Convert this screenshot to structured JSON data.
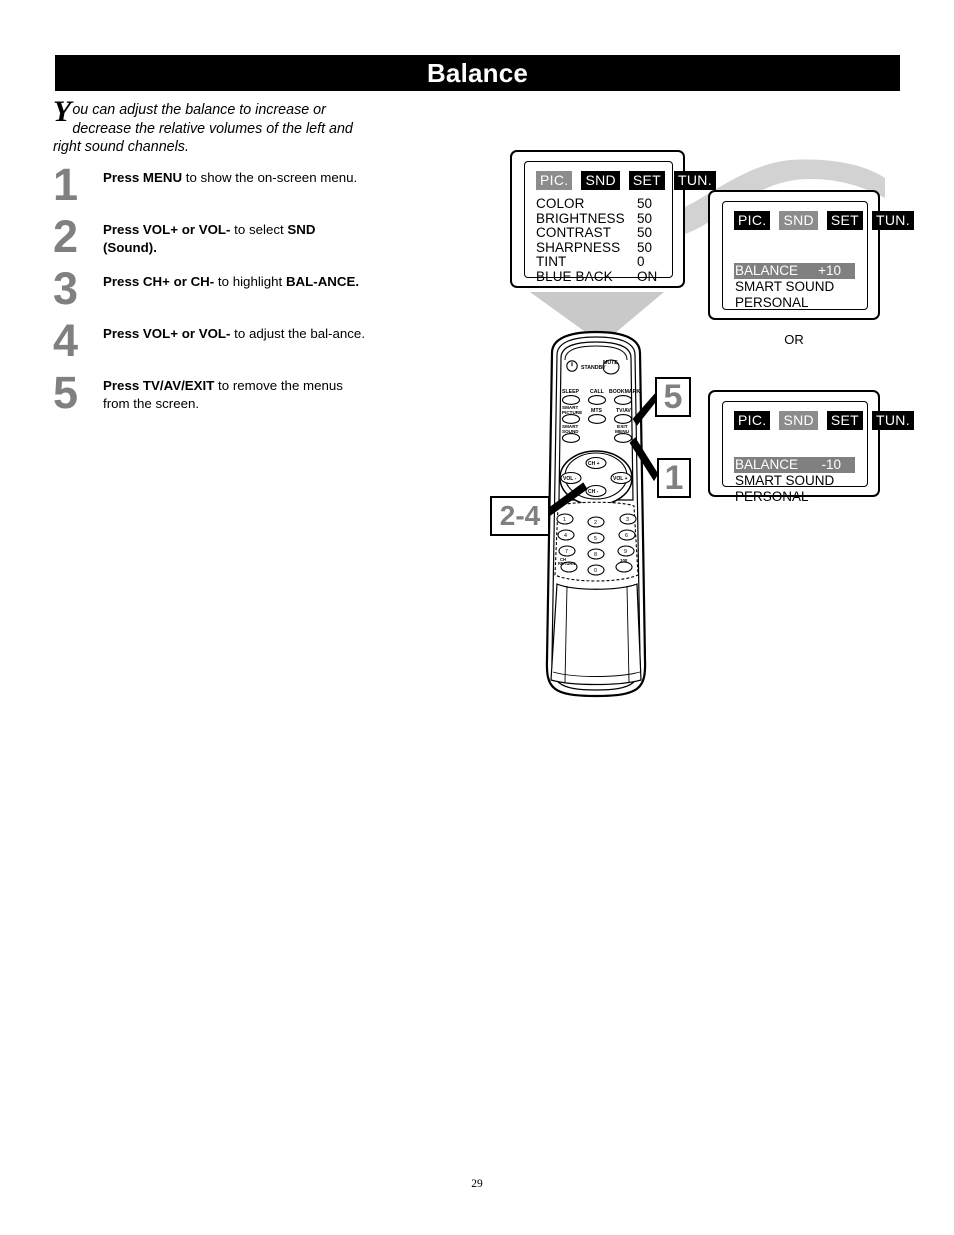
{
  "page": {
    "title": "Balance",
    "number": "29"
  },
  "intro": {
    "dropcap": "Y",
    "body": "ou can adjust the balance to increase or decrease the relative volumes of the left and right sound channels."
  },
  "steps": [
    {
      "number": "1",
      "bold_lead": "Press MENU",
      "rest": " to show the on-screen menu.",
      "bold_tail": ""
    },
    {
      "number": "2",
      "bold_lead": "Press VOL+ or VOL-",
      "rest": " to select ",
      "bold_tail": "SND (Sound)."
    },
    {
      "number": "3",
      "bold_lead": "Press CH+ or CH-",
      "rest": " to highlight ",
      "bold_tail": "BAL-ANCE."
    },
    {
      "number": "4",
      "bold_lead": "Press VOL+ or VOL-",
      "rest": " to adjust the bal-ance.",
      "bold_tail": ""
    },
    {
      "number": "5",
      "bold_lead": "Press TV/AV/EXIT",
      "rest": " to remove the menus from the screen.",
      "bold_tail": ""
    }
  ],
  "osd_picture": {
    "tabs": [
      {
        "label": "PIC.",
        "selected": true
      },
      {
        "label": "SND",
        "selected": false
      },
      {
        "label": "SET",
        "selected": false
      },
      {
        "label": "TUN.",
        "selected": false
      }
    ],
    "rows": [
      {
        "label": "COLOR",
        "value": "50"
      },
      {
        "label": "BRIGHTNESS",
        "value": "50"
      },
      {
        "label": "CONTRAST",
        "value": "50"
      },
      {
        "label": "SHARPNESS",
        "value": "50"
      },
      {
        "label": "TINT",
        "value": "0"
      },
      {
        "label": "BLUE BACK",
        "value": "ON"
      }
    ]
  },
  "osd_sound_plus": {
    "tabs": [
      {
        "label": "PIC.",
        "selected": false
      },
      {
        "label": "SND",
        "selected": true
      },
      {
        "label": "SET",
        "selected": false
      },
      {
        "label": "TUN.",
        "selected": false
      }
    ],
    "balance_label": "BALANCE",
    "balance_value": "+10",
    "smart_sound": "SMART SOUND PERSONAL"
  },
  "osd_sound_minus": {
    "tabs": [
      {
        "label": "PIC.",
        "selected": false
      },
      {
        "label": "SND",
        "selected": true
      },
      {
        "label": "SET",
        "selected": false
      },
      {
        "label": "TUN.",
        "selected": false
      }
    ],
    "balance_label": "BALANCE",
    "balance_value": "-10",
    "smart_sound": "SMART SOUND PERSONAL"
  },
  "or_label": "OR",
  "callouts": {
    "exit": "5",
    "menu": "1",
    "navigate": "2-4"
  },
  "remote": {
    "standby_label": "STANDBY",
    "mute_label": "MUTE",
    "buttons_row1": [
      "SLEEP",
      "CALL",
      "BOOKMARK"
    ],
    "buttons_row2": [
      "SMART PICTURE",
      "MTS",
      "TV/AV"
    ],
    "buttons_row3": [
      "SMART SOUND",
      "",
      "EXIT MENU"
    ],
    "dpad": [
      "CH +",
      "VOL -",
      "VOL +",
      "CH -"
    ],
    "keypad": [
      "1",
      "2",
      "3",
      "4",
      "5",
      "6",
      "7",
      "8",
      "9",
      "0"
    ],
    "keypad_extra_left": "CH RETURN",
    "keypad_extra_right": "100"
  },
  "colors": {
    "title_bar": "#000000",
    "step_number": "#808080",
    "osd_highlight": "#808080",
    "arrow_gray": "#cfcfcf"
  }
}
